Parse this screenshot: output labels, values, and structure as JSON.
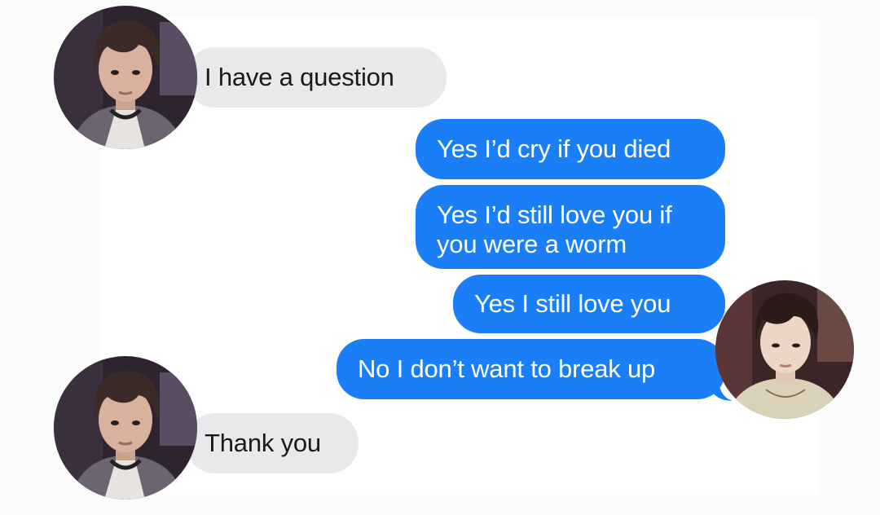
{
  "conversation": {
    "messages": [
      {
        "direction": "incoming",
        "text": "I have a question"
      },
      {
        "direction": "outgoing",
        "text": "Yes I’d cry if you died"
      },
      {
        "direction": "outgoing",
        "text": "Yes I’d still love you if you were a worm"
      },
      {
        "direction": "outgoing",
        "text": "Yes I still love you"
      },
      {
        "direction": "outgoing",
        "text": "No I don’t want to break up"
      },
      {
        "direction": "incoming",
        "text": "Thank you"
      }
    ]
  },
  "colors": {
    "outgoing_bubble": "#1a7ff7",
    "incoming_bubble": "#e9e9eb",
    "outgoing_text": "#ffffff",
    "incoming_text": "#1a1a1a",
    "page_background": "#fbfbfb",
    "chat_background": "#ffffff"
  },
  "avatars": {
    "left": {
      "icon": "person-photo-icon"
    },
    "right": {
      "icon": "person-photo-icon"
    }
  }
}
